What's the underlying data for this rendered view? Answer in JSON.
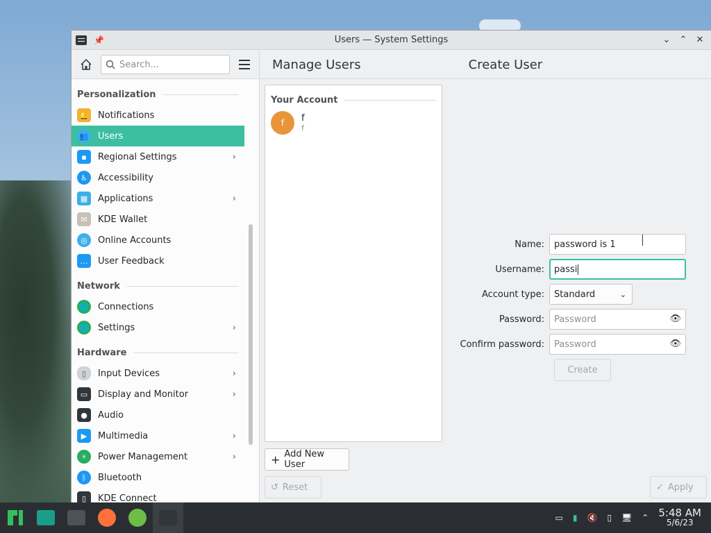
{
  "window": {
    "title": "Users — System Settings"
  },
  "sidebar": {
    "search_placeholder": "Search...",
    "groups": [
      {
        "label": "Personalization",
        "items": [
          {
            "label": "Notifications",
            "icon": "bell-icon",
            "chevron": false
          },
          {
            "label": "Users",
            "icon": "users-icon",
            "chevron": false,
            "active": true
          },
          {
            "label": "Regional Settings",
            "icon": "regional-icon",
            "chevron": true
          },
          {
            "label": "Accessibility",
            "icon": "accessibility-icon",
            "chevron": false
          },
          {
            "label": "Applications",
            "icon": "applications-icon",
            "chevron": true
          },
          {
            "label": "KDE Wallet",
            "icon": "wallet-icon",
            "chevron": false
          },
          {
            "label": "Online Accounts",
            "icon": "online-accounts-icon",
            "chevron": false
          },
          {
            "label": "User Feedback",
            "icon": "feedback-icon",
            "chevron": false
          }
        ]
      },
      {
        "label": "Network",
        "items": [
          {
            "label": "Connections",
            "icon": "globe-icon",
            "chevron": false
          },
          {
            "label": "Settings",
            "icon": "globe-icon",
            "chevron": true
          }
        ]
      },
      {
        "label": "Hardware",
        "items": [
          {
            "label": "Input Devices",
            "icon": "mouse-icon",
            "chevron": true
          },
          {
            "label": "Display and Monitor",
            "icon": "monitor-icon",
            "chevron": true
          },
          {
            "label": "Audio",
            "icon": "speaker-icon",
            "chevron": false
          },
          {
            "label": "Multimedia",
            "icon": "multimedia-icon",
            "chevron": true
          },
          {
            "label": "Power Management",
            "icon": "power-icon",
            "chevron": true
          },
          {
            "label": "Bluetooth",
            "icon": "bluetooth-icon",
            "chevron": false
          },
          {
            "label": "KDE Connect",
            "icon": "phone-icon",
            "chevron": false
          }
        ]
      }
    ]
  },
  "main": {
    "left_title": "Manage Users",
    "right_title": "Create User",
    "accounts": {
      "group_label": "Your Account",
      "user": {
        "avatar_letter": "f",
        "name": "f",
        "username": "f"
      }
    },
    "add_user_label": "Add New User",
    "reset_label": "Reset",
    "apply_label": "Apply"
  },
  "form": {
    "name_label": "Name:",
    "name_value": "password is 1",
    "username_label": "Username:",
    "username_value": "passi",
    "account_type_label": "Account type:",
    "account_type_value": "Standard",
    "password_label": "Password:",
    "password_placeholder": "Password",
    "confirm_label": "Confirm password:",
    "confirm_placeholder": "Password",
    "create_label": "Create"
  },
  "taskbar": {
    "time": "5:48 AM",
    "date": "5/6/23"
  },
  "colors": {
    "accent": "#3bbfa0",
    "avatar": "#e9943a",
    "taskbar": "#2a2e32"
  }
}
